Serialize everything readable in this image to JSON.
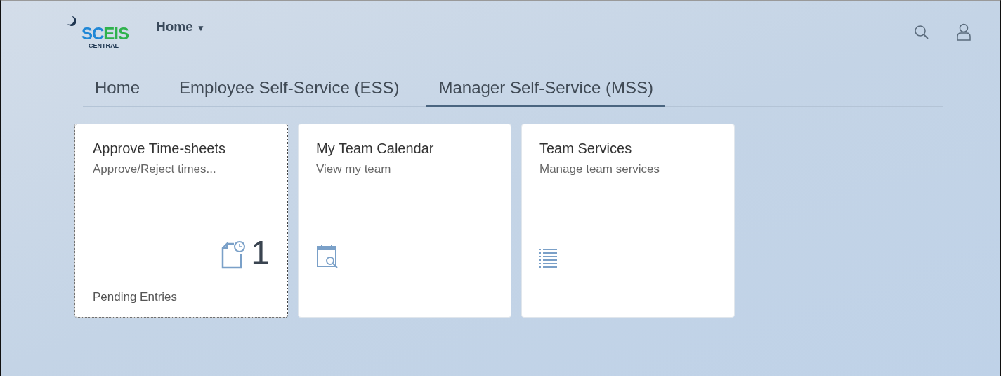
{
  "header": {
    "logo": {
      "main_part1": "SC",
      "main_part2": "EIS",
      "sub": "CENTRAL"
    },
    "menu": {
      "label": "Home",
      "caret": "▼"
    }
  },
  "tabs": [
    {
      "label": "Home",
      "selected": false
    },
    {
      "label": "Employee Self-Service (ESS)",
      "selected": false
    },
    {
      "label": "Manager Self-Service (MSS)",
      "selected": true
    }
  ],
  "tiles": [
    {
      "kind": "timesheet",
      "title": "Approve Time-sheets",
      "subtitle": "Approve/Reject times...",
      "count": "1",
      "footer": "Pending Entries",
      "focused": true
    },
    {
      "kind": "calendar",
      "title": "My Team Calendar",
      "subtitle": "View my team",
      "focused": false
    },
    {
      "kind": "list",
      "title": "Team Services",
      "subtitle": "Manage team services",
      "focused": false
    }
  ]
}
